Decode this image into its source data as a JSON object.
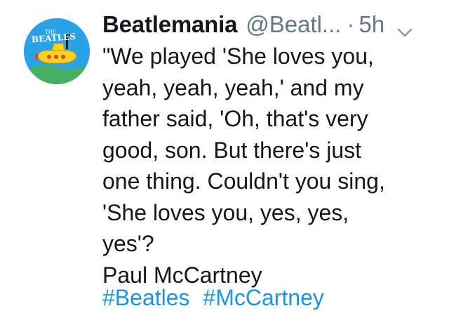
{
  "tweet": {
    "avatar_icon": "beatles-yellow-submarine-logo-icon",
    "display_name": "Beatlemania",
    "handle": "@Beatl...",
    "separator": "·",
    "time": "5h",
    "menu_icon": "chevron-down-icon",
    "text_lines": [
      "\"We played 'She loves you,",
      "yeah, yeah, yeah,' and my",
      "father said, 'Oh, that's very",
      "good, son. But there's just",
      "one thing. Couldn't you sing,",
      "'She loves you, yes, yes,",
      "yes'?",
      "Paul McCartney"
    ],
    "hashtags": [
      "#Beatles",
      "#McCartney"
    ]
  },
  "colors": {
    "avatar_bg": "#2aa3e6",
    "text": "#14171a",
    "muted": "#657786",
    "link": "#1b95e0"
  },
  "logo_text": {
    "small": "THE",
    "large": "BEATLES"
  }
}
